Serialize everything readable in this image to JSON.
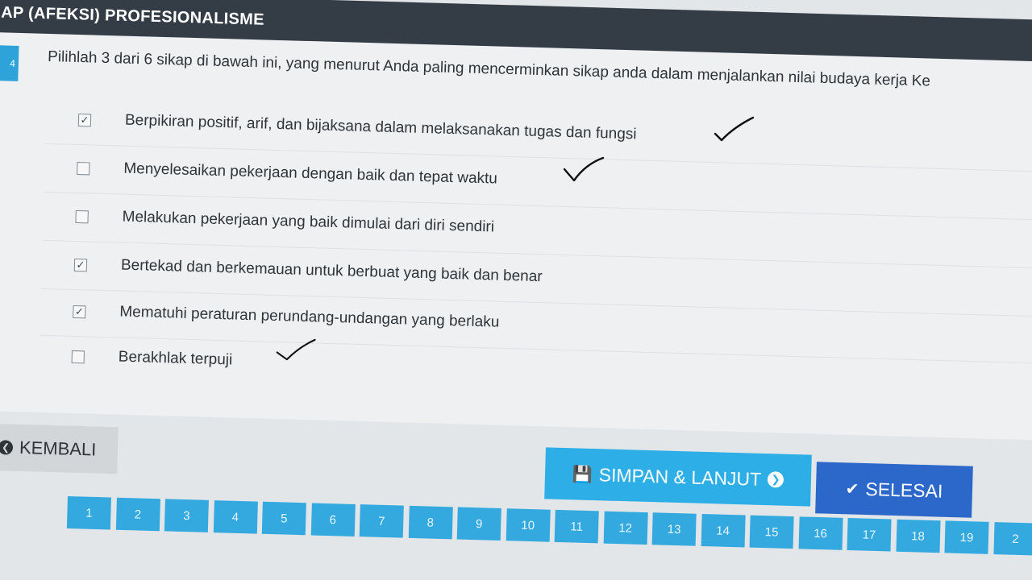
{
  "header": {
    "title": "AP (AFEKSI) PROFESIONALISME"
  },
  "question": {
    "number": "4",
    "text": "Pilihlah 3 dari 6 sikap di bawah ini, yang menurut Anda paling mencerminkan sikap anda dalam menjalankan nilai budaya kerja Ke"
  },
  "options": [
    {
      "label": "Berpikiran positif, arif, dan bijaksana dalam melaksanakan tugas dan fungsi",
      "checked": true,
      "hand_mark": true
    },
    {
      "label": "Menyelesaikan pekerjaan dengan baik dan tepat waktu",
      "checked": false,
      "hand_mark": true
    },
    {
      "label": "Melakukan pekerjaan yang baik dimulai dari diri sendiri",
      "checked": false,
      "hand_mark": false
    },
    {
      "label": "Bertekad dan berkemauan untuk berbuat yang baik dan benar",
      "checked": true,
      "hand_mark": false
    },
    {
      "label": "Mematuhi peraturan perundang-undangan yang berlaku",
      "checked": true,
      "hand_mark": false
    },
    {
      "label": "Berakhlak terpuji",
      "checked": false,
      "hand_mark": true
    }
  ],
  "buttons": {
    "back": "KEMBALI",
    "save_next": "SIMPAN & LANJUT",
    "finish": "SELESAI"
  },
  "pagination": [
    "1",
    "2",
    "3",
    "4",
    "5",
    "6",
    "7",
    "8",
    "9",
    "10",
    "11",
    "12",
    "13",
    "14",
    "15",
    "16",
    "17",
    "18",
    "19",
    "2"
  ],
  "colors": {
    "header_bg": "#343d46",
    "primary_blue": "#2eaee6",
    "finish_blue": "#2c68c9",
    "page_blue": "#33a9e0"
  }
}
